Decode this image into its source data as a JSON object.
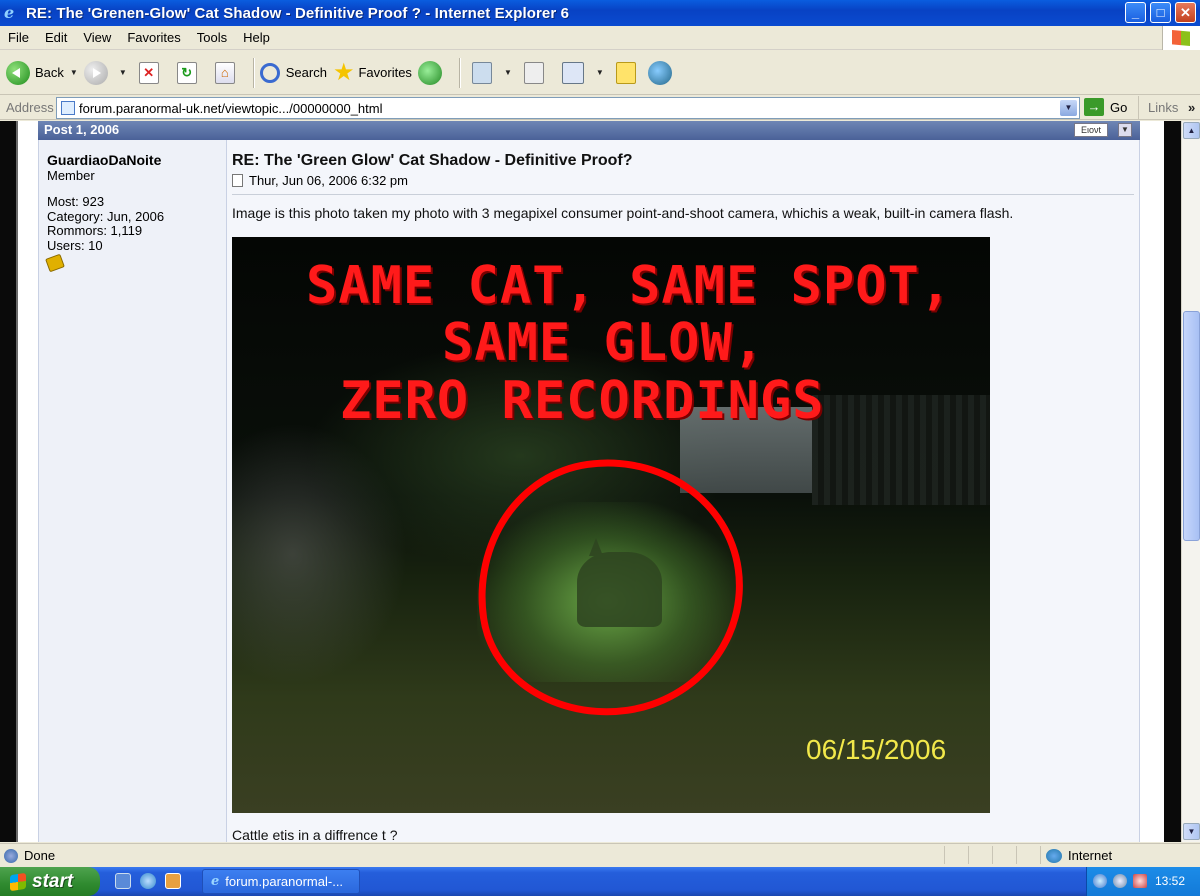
{
  "window": {
    "title": "RE: The 'Grenen-Glow' Cat Shadow - Definitive Proof ? - Internet Explorer 6",
    "minimize": "_",
    "maximize": "□",
    "close": "✕"
  },
  "menu": [
    {
      "key": "F",
      "rest": "ile"
    },
    {
      "key": "E",
      "rest": "dit"
    },
    {
      "key": "V",
      "rest": "iew"
    },
    {
      "key": "",
      "rest": "Favorites",
      "key_pos": "a"
    },
    {
      "key": "T",
      "rest": "ools"
    },
    {
      "key": "H",
      "rest": "elp"
    }
  ],
  "menu_labels": {
    "file": "File",
    "edit": "Edit",
    "view": "View",
    "favorites": "Favorites",
    "tools": "Tools",
    "help": "Help"
  },
  "toolbar": {
    "back": "Back",
    "search": "Search",
    "favorites": "Favorites",
    "icons": [
      "back-icon",
      "forward-icon",
      "stop-icon",
      "refresh-icon",
      "home-icon",
      "search-icon",
      "favorites-star-icon",
      "history-icon",
      "mail-icon",
      "print-icon",
      "edit-icon",
      "discuss-icon",
      "messenger-icon"
    ]
  },
  "address": {
    "label": "Address",
    "url": "forum.paranormal-uk.net/viewtopic.../00000000_html",
    "go": "Go",
    "links": "Links",
    "links_chevron": "»"
  },
  "post": {
    "header": "Post 1, 2006",
    "header_btn": "Eιονt",
    "author": {
      "name": "GuardiaoDaNoite",
      "rank": "Member",
      "stats": [
        "Most: 923",
        "Category: Jun, 2006",
        "Rommors: 1,119",
        "Users: 10"
      ]
    },
    "subject": "RE: The 'Green Glow' Cat Shadow - Definitive Proof?",
    "date": "Thur, Jun 06, 2006 6:32 pm",
    "text": "Image is this photo taken my photo with 3 megapixel consumer point-and-shoot camera, whichis a weak, built-in camera flash.",
    "image_overlay": {
      "line1": "SAME CAT, SAME SPOT,",
      "line2": "SAME GLOW,",
      "line3": "ZERO RECORDINGS",
      "date_stamp": "06/15/2006"
    },
    "cut_text": "Cattle etis in a diffrence t ?"
  },
  "status": {
    "text": "Done",
    "zone": "Internet"
  },
  "taskbar": {
    "start": "start",
    "task": "forum.paranormal-...",
    "clock": "13:52"
  },
  "colors": {
    "title_bar": "#0842c4",
    "post_header": "#5a70a6",
    "overlay_red": "#ff1a1a",
    "date_yellow": "#f2e84a"
  }
}
